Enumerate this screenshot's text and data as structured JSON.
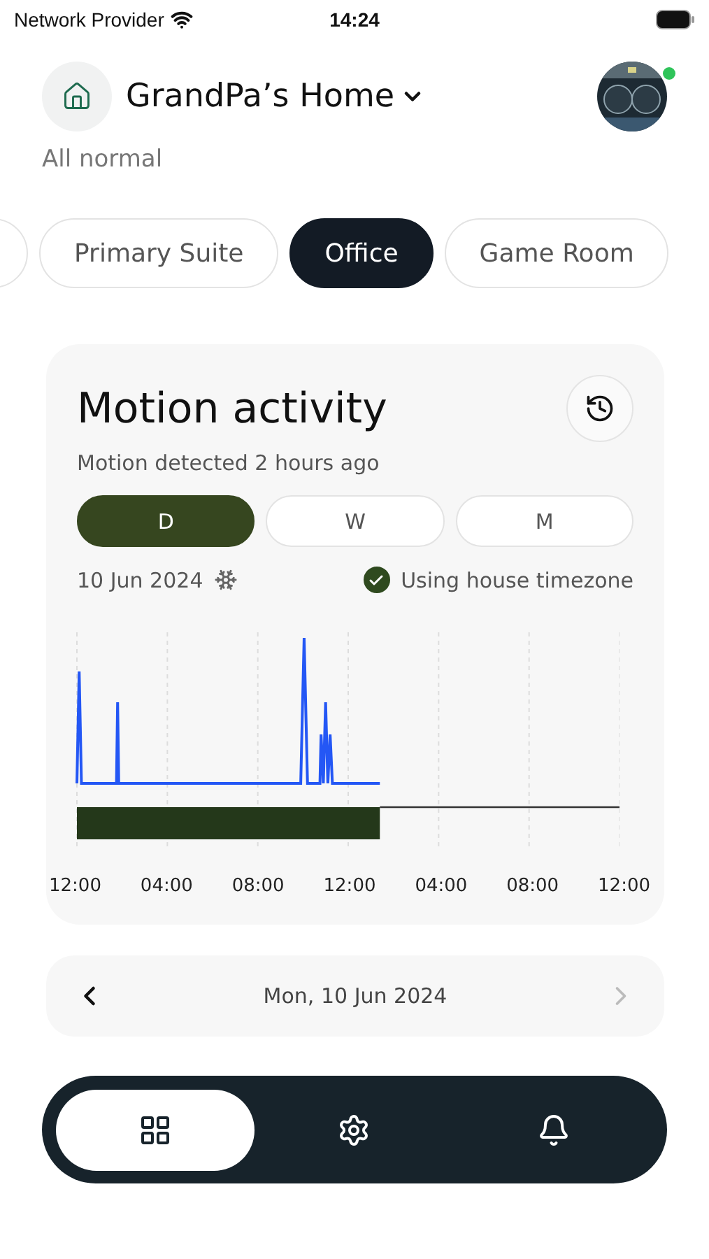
{
  "status_bar": {
    "carrier": "Network Provider",
    "time": "14:24"
  },
  "header": {
    "home_name": "GrandPa’s Home",
    "status": "All normal",
    "avatar": {
      "kind": "picture",
      "online": true
    }
  },
  "rooms": [
    {
      "selected": false
    },
    {
      "label": "Primary Suite",
      "selected": false
    },
    {
      "label": "Office",
      "selected": true
    },
    {
      "label": "Game Room",
      "selected": false
    }
  ],
  "card": {
    "title": "Motion activity",
    "subtitle": "Motion detected 2 hours ago",
    "periods": [
      {
        "label": "D",
        "selected": true
      },
      {
        "label": "W",
        "selected": false
      },
      {
        "label": "M",
        "selected": false
      }
    ],
    "date": "10 Jun 2024",
    "timezone": {
      "label": "Using house timezone",
      "checked": true
    },
    "x_labels": [
      "12:00",
      "04:00",
      "08:00",
      "12:00",
      "04:00",
      "08:00",
      "12:00"
    ]
  },
  "date_nav": {
    "label": "Mon, 10 Jun 2024",
    "next_disabled": true
  },
  "bottom_nav": [
    {
      "kind": "grid",
      "selected": true
    },
    {
      "kind": "gear",
      "selected": false
    },
    {
      "kind": "bell",
      "selected": false
    }
  ]
}
